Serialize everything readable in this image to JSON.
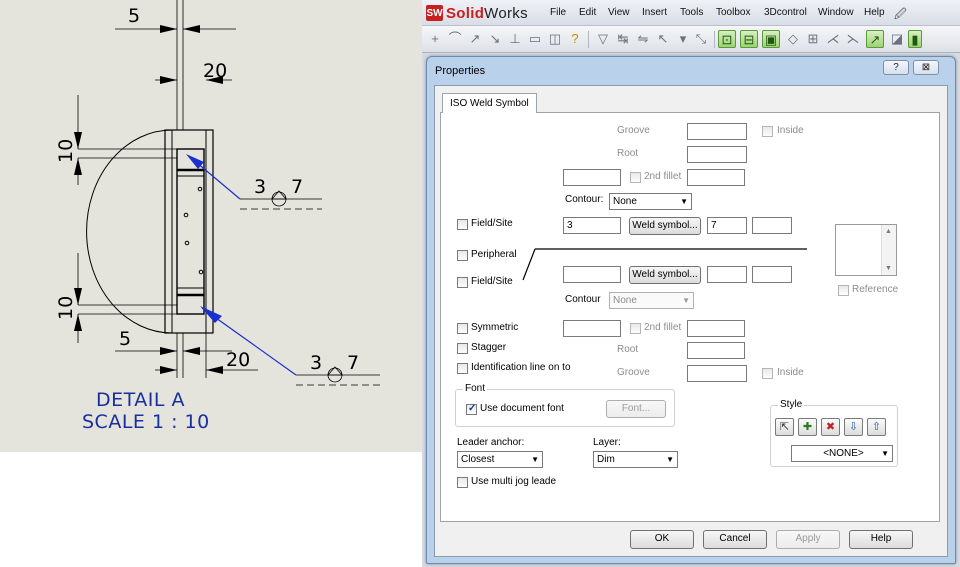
{
  "drawing": {
    "dimensions": {
      "top_5": "5",
      "top_20": "20",
      "left_10_top": "10",
      "left_10_bottom": "10",
      "bottom_5": "5",
      "bottom_20": "20",
      "weld_top_size": "3",
      "weld_top_length": "7",
      "weld_bottom_size": "3",
      "weld_bottom_length": "7"
    },
    "detail_label": "DETAIL A",
    "scale_label": "SCALE 1 : 10"
  },
  "app": {
    "logo_text_bold": "Solid",
    "logo_text_rest": "Works",
    "menu": [
      "File",
      "Edit",
      "View",
      "Insert",
      "Tools",
      "Toolbox",
      "3Dcontrol",
      "Window",
      "Help"
    ]
  },
  "dialog": {
    "title": "Properties",
    "help_btn": "?",
    "close_btn": "⊠",
    "tab": "ISO Weld Symbol",
    "upper": {
      "groove_label": "Groove",
      "inside_label": "Inside",
      "root_label": "Root",
      "second_fillet_label": "2nd fillet",
      "contour_label": "Contour:",
      "contour_value": "None",
      "field_site_label": "Field/Site",
      "weld_value": "3",
      "weld_symbol_btn": "Weld symbol...",
      "length_value": "7",
      "peripheral_label": "Peripheral"
    },
    "lower": {
      "field_site_label": "Field/Site",
      "weld_symbol_btn": "Weld symbol...",
      "contour_label": "Contour",
      "contour_value": "None",
      "reference_label": "Reference"
    },
    "options": {
      "symmetric_label": "Symmetric",
      "second_fillet_label": "2nd fillet",
      "stagger_label": "Stagger",
      "root_label": "Root",
      "id_line_label": "Identification line on to",
      "groove_label": "Groove",
      "inside_label": "Inside"
    },
    "font_group": {
      "title": "Font",
      "use_doc_font_label": "Use document font",
      "use_doc_font_checked": true,
      "font_btn": "Font..."
    },
    "style_group": {
      "title": "Style",
      "icons": [
        "style-add-icon",
        "style-update-icon",
        "style-delete-icon",
        "style-save-icon",
        "style-load-icon"
      ],
      "value": "<NONE>"
    },
    "leader": {
      "anchor_label": "Leader anchor:",
      "anchor_value": "Closest",
      "layer_label": "Layer:",
      "layer_value": "Dim",
      "multi_jog_label": "Use multi jog leade"
    },
    "buttons": {
      "ok": "OK",
      "cancel": "Cancel",
      "apply": "Apply",
      "help": "Help"
    }
  }
}
